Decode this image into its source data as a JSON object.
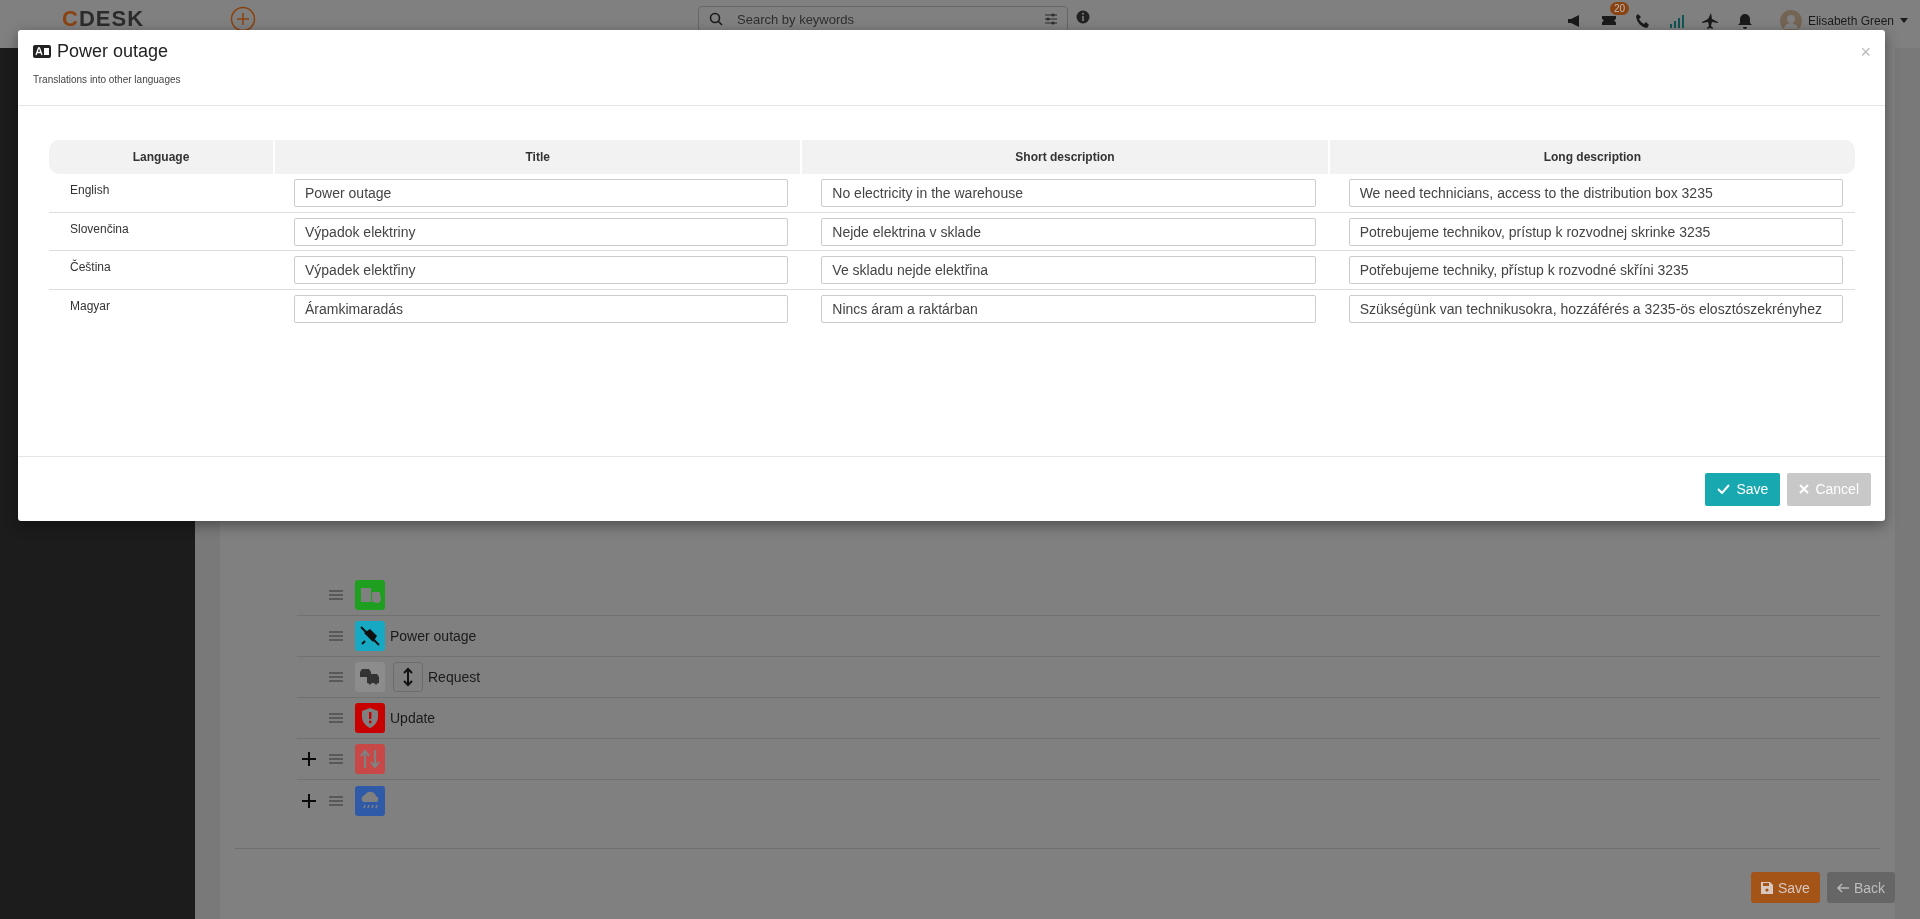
{
  "topbar": {
    "logo": "CDESK",
    "search_placeholder": "Search by keywords",
    "badge_count": "20",
    "user_name": "Elisabeth Green"
  },
  "list": {
    "items": [
      {
        "kind": "plain",
        "color": "#1f9f1f"
      },
      {
        "kind": "plain",
        "color": "#17a9c3",
        "label": "Power outage"
      },
      {
        "kind": "sortable",
        "color": "#8c8c8c",
        "label": "Request"
      },
      {
        "kind": "plain",
        "color": "#c80000",
        "label": "Update"
      },
      {
        "kind": "expandable",
        "color": "#c84848"
      },
      {
        "kind": "expandable",
        "color": "#2e5aa8"
      }
    ]
  },
  "page_buttons": [
    {
      "kind": "save",
      "label": "Save"
    },
    {
      "kind": "back",
      "label": "Back"
    }
  ],
  "modal": {
    "title": "Power outage",
    "subtitle": "Translations into other languages",
    "close": "×",
    "columns": [
      "Language",
      "Title",
      "Short description",
      "Long description"
    ],
    "rows": [
      {
        "language": "English",
        "title": "Power outage",
        "short_description": "No electricity in the warehouse",
        "long_description": "We need technicians, access to the distribution box 3235"
      },
      {
        "language": "Slovenčina",
        "title": "Výpadok elektriny",
        "short_description": "Nejde elektrina v sklade",
        "long_description": "Potrebujeme technikov, prístup k rozvodnej skrinke 3235"
      },
      {
        "language": "Čeština",
        "title": "Výpadek elektřiny",
        "short_description": "Ve skladu nejde elektřina",
        "long_description": "Potřebujeme techniky, přístup k rozvodné skříni 3235"
      },
      {
        "language": "Magyar",
        "title": "Áramkimaradás",
        "short_description": "Nincs áram a raktárban",
        "long_description": "Szükségünk van technikusokra, hozzáférés a 3235-ös elosztószekrényhez"
      }
    ],
    "buttons": [
      {
        "kind": "save",
        "label": "Save"
      },
      {
        "kind": "cancel",
        "label": "Cancel"
      }
    ]
  }
}
